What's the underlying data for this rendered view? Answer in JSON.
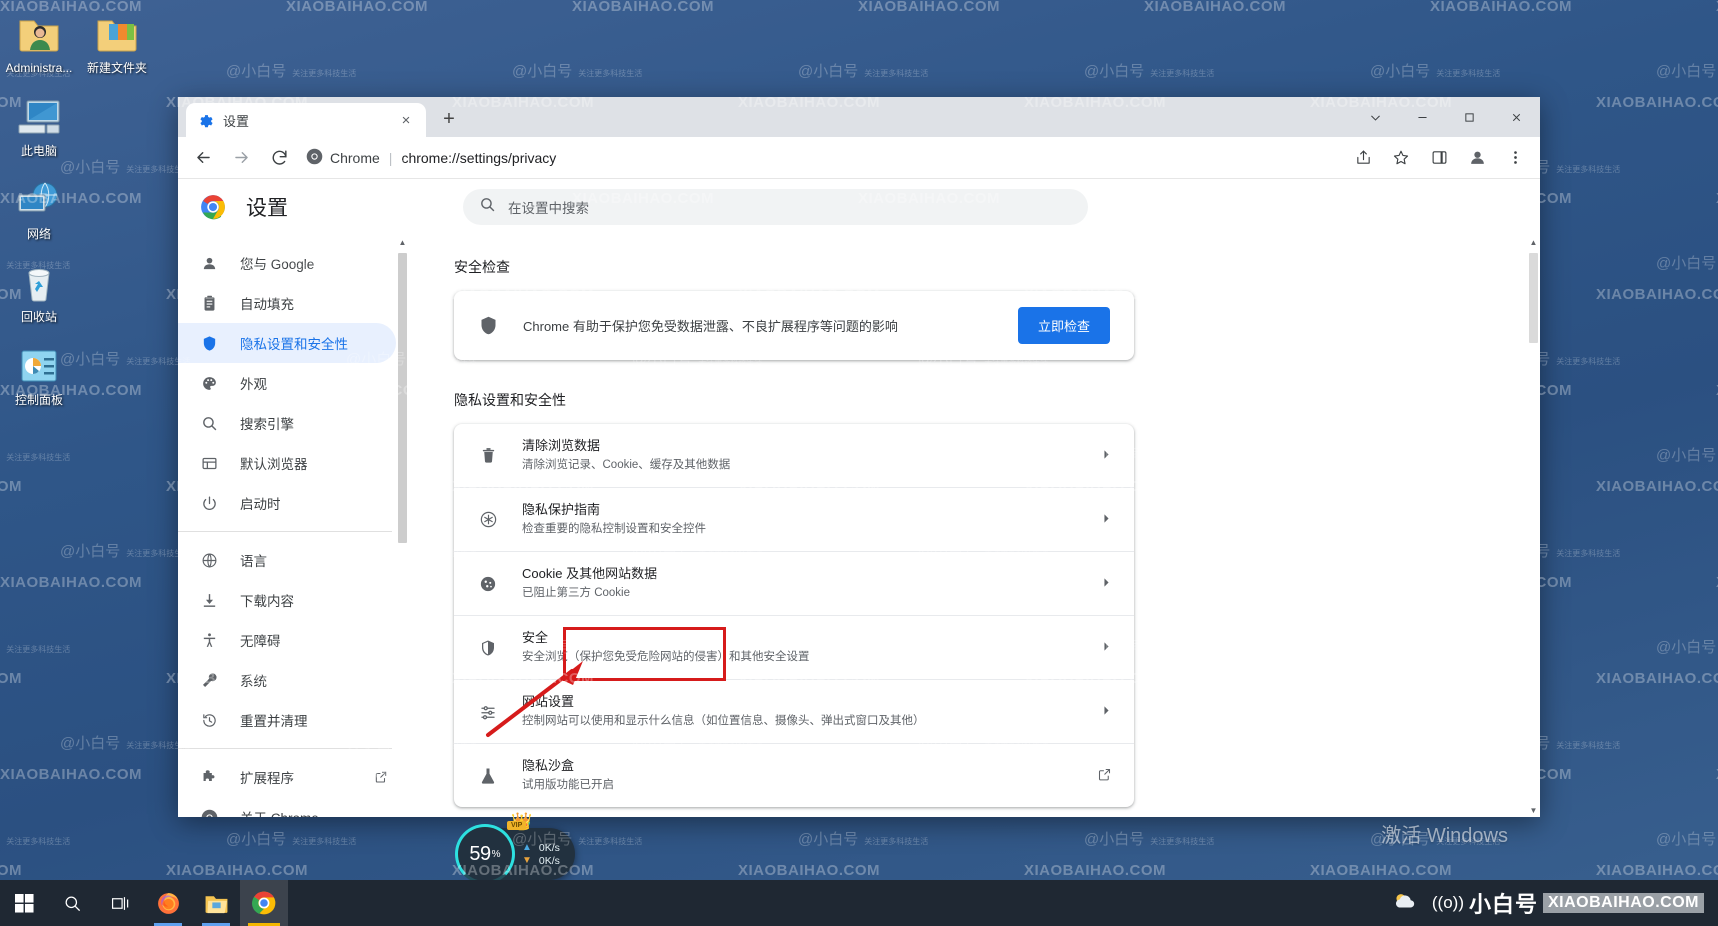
{
  "desktop": {
    "icons": [
      {
        "label": "Administra...",
        "icon": "user-folder-icon"
      },
      {
        "label": "新建文件夹",
        "icon": "folder-icon"
      },
      {
        "label": "此电脑",
        "icon": "computer-icon"
      },
      {
        "label": "网络",
        "icon": "network-icon"
      },
      {
        "label": "回收站",
        "icon": "recycle-bin-icon"
      },
      {
        "label": "控制面板",
        "icon": "control-panel-icon"
      }
    ],
    "activate_watermark": "激活 Windows"
  },
  "watermark": {
    "domain": "XIAOBAIHAO.COM",
    "cn": "@小白号",
    "cn_sub": "关注更多科技生活"
  },
  "browser": {
    "tab": {
      "title": "设置",
      "favicon": "gear-icon",
      "close": "×"
    },
    "new_tab": "+",
    "window_controls": {
      "collapse": "⌄",
      "minimize": "—",
      "maximize": "□",
      "close": "✕"
    },
    "toolbar": {
      "back": "←",
      "forward": "→",
      "reload": "⟳",
      "scheme_label": "Chrome",
      "url": "chrome://settings/privacy",
      "share": "share-icon",
      "bookmark": "star-icon",
      "sidepanel": "side-panel-icon",
      "profile": "profile-avatar-icon",
      "menu": "three-dot-menu-icon"
    }
  },
  "settings": {
    "title": "设置",
    "search_placeholder": "在设置中搜索",
    "nav": [
      {
        "label": "您与 Google",
        "icon": "person-icon",
        "active": false
      },
      {
        "label": "自动填充",
        "icon": "clipboard-icon",
        "active": false
      },
      {
        "label": "隐私设置和安全性",
        "icon": "shield-icon",
        "active": true
      },
      {
        "label": "外观",
        "icon": "palette-icon",
        "active": false
      },
      {
        "label": "搜索引擎",
        "icon": "search-icon",
        "active": false
      },
      {
        "label": "默认浏览器",
        "icon": "browser-window-icon",
        "active": false
      },
      {
        "label": "启动时",
        "icon": "power-icon",
        "active": false
      },
      {
        "label": "语言",
        "icon": "globe-icon",
        "active": false
      },
      {
        "label": "下载内容",
        "icon": "download-icon",
        "active": false
      },
      {
        "label": "无障碍",
        "icon": "accessibility-icon",
        "active": false
      },
      {
        "label": "系统",
        "icon": "wrench-icon",
        "active": false
      },
      {
        "label": "重置并清理",
        "icon": "history-restore-icon",
        "active": false
      },
      {
        "label": "扩展程序",
        "icon": "puzzle-icon",
        "active": false,
        "external": true
      },
      {
        "label": "关于 Chrome",
        "icon": "chrome-logo-icon",
        "active": false
      }
    ],
    "safety_check": {
      "heading": "安全检查",
      "description": "Chrome 有助于保护您免受数据泄露、不良扩展程序等问题的影响",
      "button": "立即检查",
      "icon": "shield-filled-icon"
    },
    "privacy_section": {
      "heading": "隐私设置和安全性",
      "rows": [
        {
          "title": "清除浏览数据",
          "subtitle": "清除浏览记录、Cookie、缓存及其他数据",
          "icon": "trash-icon",
          "action": "chevron-right-icon",
          "highlighted": false
        },
        {
          "title": "隐私保护指南",
          "subtitle": "检查重要的隐私控制设置和安全控件",
          "icon": "privacy-guide-icon",
          "action": "chevron-right-icon",
          "highlighted": false
        },
        {
          "title": "Cookie 及其他网站数据",
          "subtitle": "已阻止第三方 Cookie",
          "icon": "cookie-icon",
          "action": "chevron-right-icon",
          "highlighted": false
        },
        {
          "title": "安全",
          "subtitle": "安全浏览（保护您免受危险网站的侵害）和其他安全设置",
          "icon": "shield-outline-icon",
          "action": "chevron-right-icon",
          "highlighted": true
        },
        {
          "title": "网站设置",
          "subtitle": "控制网站可以使用和显示什么信息（如位置信息、摄像头、弹出式窗口及其他）",
          "icon": "sliders-icon",
          "action": "chevron-right-icon",
          "highlighted": false
        },
        {
          "title": "隐私沙盒",
          "subtitle": "试用版功能已开启",
          "icon": "flask-icon",
          "action": "open-external-icon",
          "highlighted": false
        }
      ]
    }
  },
  "annotation": {
    "highlight_color": "#d61b1b",
    "target": "安全"
  },
  "speed_widget": {
    "percent": "59",
    "percent_unit": "%",
    "upload": "0K/s",
    "download": "0K/s",
    "badge": "VIP"
  },
  "taskbar": {
    "left": [
      {
        "name": "start-button",
        "icon": "windows-logo-icon"
      },
      {
        "name": "search-button",
        "icon": "search-icon"
      },
      {
        "name": "task-view-button",
        "icon": "task-view-icon"
      },
      {
        "name": "firefox-button",
        "icon": "firefox-icon"
      },
      {
        "name": "file-explorer-button",
        "icon": "folder-icon"
      },
      {
        "name": "chrome-button",
        "icon": "chrome-icon"
      }
    ],
    "right": {
      "weather": "weather-icon",
      "wifi": "((o))",
      "brand_cn": "小白号",
      "brand_domain": "XIAOBAIHAO.COM"
    }
  }
}
